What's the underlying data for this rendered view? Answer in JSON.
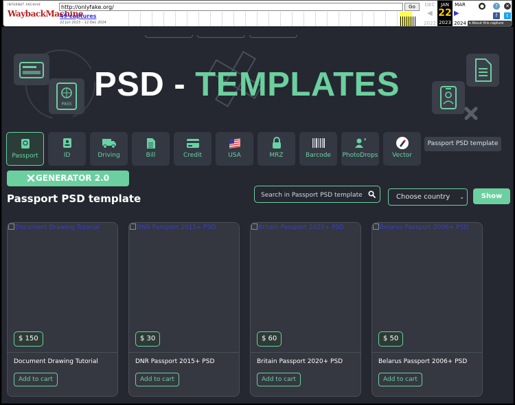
{
  "wayback": {
    "logo_top": "INTERNET ARCHIVE",
    "logo_main": "WaybackMachine",
    "url": "http://onlyfake.org/",
    "go_label": "Go",
    "captures": "49 captures",
    "range": "22 Jun 2023 – 12 Dec 2024",
    "prev": {
      "month": "DEC",
      "year": "2022"
    },
    "current": {
      "month": "JAN",
      "day": "22",
      "year": "2023"
    },
    "next": {
      "month": "MAR",
      "year": "2024"
    },
    "about": "▾ About this capture"
  },
  "hero": {
    "title_white": "PSD - ",
    "title_green": "TEMPLATES"
  },
  "categories": [
    {
      "label": "Passport",
      "icon": "passport-icon",
      "active": true
    },
    {
      "label": "ID",
      "icon": "id-card-icon"
    },
    {
      "label": "Driving",
      "icon": "truck-icon"
    },
    {
      "label": "Bill",
      "icon": "document-icon"
    },
    {
      "label": "Credit",
      "icon": "credit-card-icon"
    },
    {
      "label": "USA",
      "icon": "usa-flag-icon"
    },
    {
      "label": "MRZ",
      "icon": "lock-icon"
    },
    {
      "label": "Barcode",
      "icon": "barcode-icon"
    },
    {
      "label": "PhotoDrops",
      "icon": "photo-drops-icon"
    },
    {
      "label": "Vector",
      "icon": "vector-pen-icon"
    }
  ],
  "category_tooltip": "Passport PSD template",
  "generator_label": "GENERATOR 2.0",
  "page_title": "Passport PSD template",
  "search": {
    "placeholder": "Search in Passport PSD template"
  },
  "country_select": {
    "selected": "Choose country"
  },
  "show_label": "Show",
  "products": [
    {
      "alt": "Document Drawing Tutorial",
      "price": "$ 150",
      "name": "Document Drawing Tutorial",
      "cart": "Add to cart"
    },
    {
      "alt": "DNR Passport 2015+ PSD",
      "price": "$ 30",
      "name": "DNR Passport 2015+ PSD",
      "cart": "Add to cart"
    },
    {
      "alt": "Britain Passport 2020+ PSD",
      "price": "$ 60",
      "name": "Britain Passport 2020+ PSD",
      "cart": "Add to cart"
    },
    {
      "alt": "Belarus Passport 2006+ PSD",
      "price": "$ 50",
      "name": "Belarus Passport 2006+ PSD",
      "cart": "Add to cart"
    }
  ],
  "colors": {
    "accent": "#6ccf9f",
    "background": "#252830",
    "card": "#353841"
  }
}
